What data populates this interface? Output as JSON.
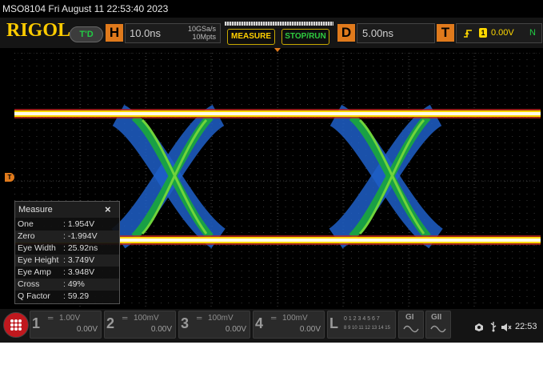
{
  "title": "MSO8104  Fri August 11 22:53:40 2023",
  "brand": "RIGOL",
  "run_state": "T'D",
  "horizontal": {
    "key": "H",
    "timebase": "10.0ns",
    "sample_rate": "10GSa/s",
    "memory_rate": "10Mpts"
  },
  "buttons": {
    "measure": "MEASURE",
    "stop_run": "STOP/RUN"
  },
  "delay": {
    "key": "D",
    "value": "5.00ns"
  },
  "trigger": {
    "key": "T",
    "source": "1",
    "level": "0.00V",
    "mode": "N"
  },
  "trigger_marker": "T",
  "measure_panel": {
    "title": "Measure",
    "close": "×",
    "rows": [
      {
        "name": "One",
        "value": ": 1.954V"
      },
      {
        "name": "Zero",
        "value": ": -1.994V"
      },
      {
        "name": "Eye Width",
        "value": ": 25.92ns"
      },
      {
        "name": "Eye Height",
        "value": ": 3.749V"
      },
      {
        "name": "Eye Amp",
        "value": ": 3.948V"
      },
      {
        "name": "Cross",
        "value": ": 49%"
      },
      {
        "name": "Q Factor",
        "value": ": 59.29"
      }
    ]
  },
  "channels": [
    {
      "num": "1",
      "scale": "1.00V",
      "offset": "0.00V"
    },
    {
      "num": "2",
      "scale": "100mV",
      "offset": "0.00V"
    },
    {
      "num": "3",
      "scale": "100mV",
      "offset": "0.00V"
    },
    {
      "num": "4",
      "scale": "100mV",
      "offset": "0.00V"
    }
  ],
  "logic": {
    "key": "L",
    "row1": "0 1 2 3  4 5 6 7",
    "row2": "8 9 10 11 12 13 14 15"
  },
  "generators": [
    {
      "label": "GI"
    },
    {
      "label": "GII"
    }
  ],
  "status": {
    "time": "22:53"
  },
  "colors": {
    "brand": "#ffcc00",
    "orange": "#e07a1c",
    "run_green": "#22cc44",
    "trace_yellow": "#ffd800",
    "eye_blue": "#1e6bd6",
    "eye_green": "#22c53a"
  }
}
